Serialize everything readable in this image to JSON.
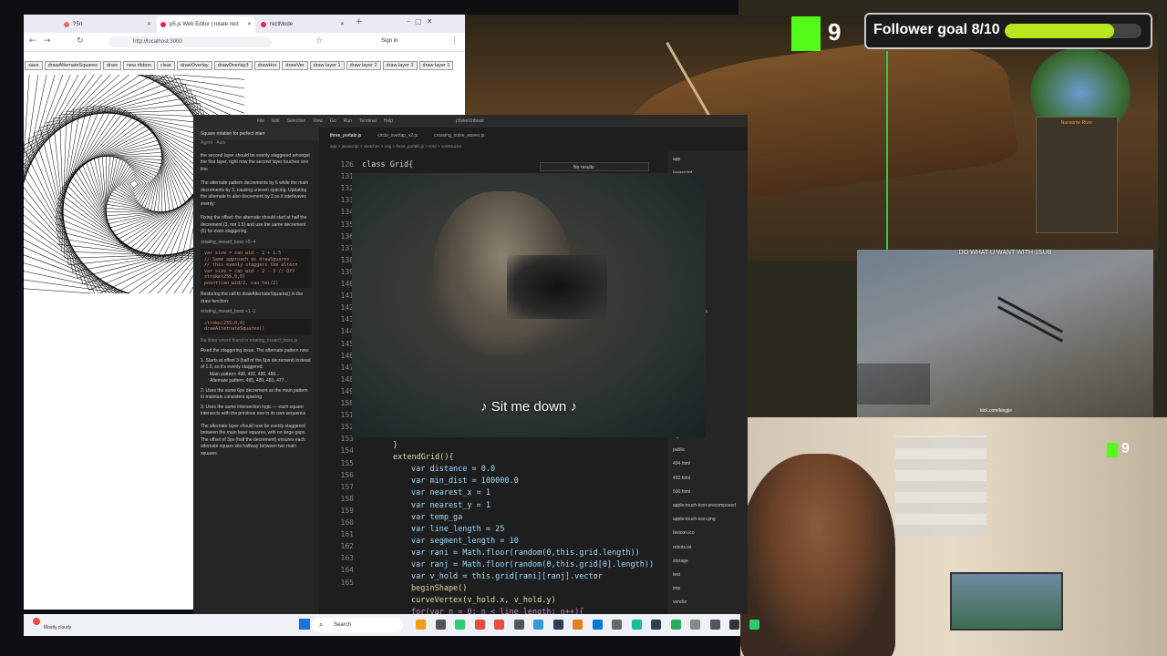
{
  "browser": {
    "tabs": [
      {
        "label": "?5rl",
        "color": "#e66"
      },
      {
        "label": "p5.js Web Editor | rotate rect",
        "color": "#ed225d"
      },
      {
        "label": "rectMode",
        "color": "#ed225d"
      }
    ],
    "new_tab": "+",
    "url": "http://localhost:3000",
    "sign_in": "Sign in",
    "p5_buttons": [
      "save",
      "drawAlternateSquares",
      "draw",
      "new ribbon",
      "clear",
      "drawOverlay",
      "drawOverlay3",
      "drawHor",
      "drawVer",
      "draw layer 1",
      "draw layer 2",
      "draw layer 3",
      "draw layer 1"
    ]
  },
  "editor": {
    "menu": [
      "File",
      "Edit",
      "Selection",
      "View",
      "Go",
      "Run",
      "Terminal",
      "Help"
    ],
    "workspace": "p5sketchbook",
    "chat_title": "Square rotation for perfect interr",
    "chat_model": "Agent · Auto",
    "tabs": [
      "three_portals.js",
      "circle_overlap_v2.js",
      "crossing_noise_waves.js"
    ],
    "breadcrumb": "app > javascript > sketches > orig > three_portals.js > Grid > constructor",
    "find_status": "No results",
    "chat": [
      "the second layer should be evenly staggered amongst the first layer, right now the second layer touches one line",
      "The alternate pattern decrements by 6 while the main decrements by 3, causing uneven spacing. Updating the alternate to also decrement by 3 so it interleaves evenly:",
      "Fixing the offset: the alternate should start at half the decrement (3, not 1.5) and use the same decrement (6) for even staggering.",
      "Restoring the call to drawAlternateSquares() in the draw function:",
      "No linter errors found in rotating_inward_boxs.js",
      "Fixed the staggering issue. The alternate pattern now:",
      "1. Starts at offset 3 (half of the 6px decrement) instead of 1.5, so it's evenly staggered:",
      "Main pattern: 498, 492, 486, 480...",
      "Alternate pattern: 495, 489, 483, 477...",
      "2. Uses the same 6px decrement as the main pattern to maintain consistent spacing",
      "3. Uses the same intersection logic — each square intersects with the previous one in its own sequence",
      "The alternate layer should now be evenly staggered between the main layer squares, with no large gaps. The offset of 3px (half the decrement) ensures each alternate square sits halfway between two main squares."
    ],
    "chat_files": [
      "rotating_inward_boxs +5 -4",
      "rotating_inward_boxs +1 -1"
    ],
    "chat_code": [
      "var size = can_wid - 2 + 1.5",
      "// Same approach as drawSquares...",
      "// this evenly staggers the altern",
      "var size = can_wid - 2 - 3  // Off",
      "stroke(255,0,0)",
      "point(can_wid/2, can_hei/2)"
    ],
    "chat_code2": [
      "stroke(255,0,0)",
      "drawAlternateSquares()"
    ],
    "line_numbers": [
      "126",
      "131",
      "132",
      "133",
      "134",
      "135",
      "136",
      "137",
      "138",
      "139",
      "140",
      "141",
      "142",
      "143",
      "144",
      "145",
      "146",
      "147",
      "148",
      "149",
      "150",
      "151",
      "152",
      "153",
      "154",
      "155",
      "156",
      "157",
      "158",
      "159",
      "160",
      "161",
      "162",
      "163",
      "164",
      "165"
    ],
    "code_top": "class Grid{",
    "code_lines": [
      "}",
      "extendGrid(){",
      "var distance = 0.0",
      "var min_dist = 100000.0",
      "var nearest_x = 1",
      "var nearest_y = 1",
      "var temp_ga",
      "var line_length = 25",
      "var segment_length = 10",
      "var rani = Math.floor(random(0,this.grid.length))",
      "var ranj = Math.floor(random(0,this.grid[0].length))",
      "var v_hold = this.grid[rani][ranj].vector",
      "beginShape()",
      "curveVertex(v_hold.x, v_hold.y)",
      "for(var n = 0; n < line_length; n++){"
    ],
    "code_line_numbers": [
      "152",
      "153",
      "154",
      "155",
      "156",
      "157",
      "158",
      "159",
      "160",
      "161",
      "162",
      "163",
      "164",
      "165",
      "166"
    ],
    "file_tree": [
      "app",
      "javascript",
      "_sandbox.js",
      "_mthe_v1.js",
      "_portals.js",
      "3.js",
      "2.js",
      "1.js",
      "stacking",
      "_noise_sin",
      "ud.js",
      "_buffer_sketch.js",
      "_job.rb",
      "erb",
      "errors.html.erb",
      "mailer.text.erb",
      "bin",
      "config",
      "db",
      "lib",
      "log",
      "public",
      "404.html",
      "422.html",
      "500.html",
      "apple-touch-icon-precomposed",
      "apple-touch-icon.png",
      "favicon.ico",
      "robots.txt",
      "storage",
      "test",
      "tmp",
      "vendor"
    ]
  },
  "video": {
    "subtitle": "♪ Sit me down ♪"
  },
  "stream": {
    "follower_label": "Follower goal 8/10",
    "follower_progress": 0.8,
    "kick_count": "9",
    "kick_color": "#53fc18",
    "rock_caption": "DO WHAT U WANT WITH 1SUB",
    "rock_handle": "kick.com/kingjie",
    "game_panel": "Nunsome River"
  },
  "taskbar": {
    "weather": "Mostly cloudy",
    "search_placeholder": "Search"
  }
}
